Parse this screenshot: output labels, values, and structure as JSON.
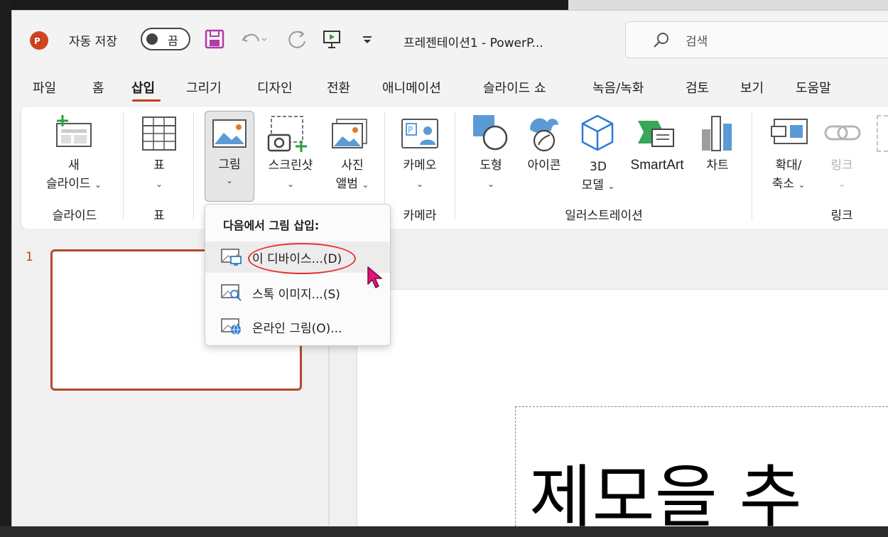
{
  "titlebar": {
    "autosave_label": "자동 저장",
    "autosave_toggle": "끔",
    "document_title": "프레젠테이션1  -  PowerP...",
    "search_placeholder": "검색"
  },
  "tabs": [
    {
      "label": "파일"
    },
    {
      "label": "홈"
    },
    {
      "label": "삽입"
    },
    {
      "label": "그리기"
    },
    {
      "label": "디자인"
    },
    {
      "label": "전환"
    },
    {
      "label": "애니메이션"
    },
    {
      "label": "슬라이드 쇼"
    },
    {
      "label": "녹음/녹화"
    },
    {
      "label": "검토"
    },
    {
      "label": "보기"
    },
    {
      "label": "도움말"
    }
  ],
  "ribbon": {
    "new_slide": {
      "line1": "새",
      "line2": "슬라이드"
    },
    "table": "표",
    "picture": "그림",
    "screenshot": "스크린샷",
    "photo_album": {
      "line1": "사진",
      "line2": "앨범"
    },
    "cameo": "카메오",
    "shapes": "도형",
    "icons": "아이콘",
    "model_3d": {
      "line1": "3D",
      "line2": "모델"
    },
    "smartart": "SmartArt",
    "chart": "차트",
    "zoom": {
      "line1": "확대/",
      "line2": "축소"
    },
    "link": "링크",
    "groups": {
      "slides": "슬라이드",
      "tables": "표",
      "camera": "카메라",
      "illustrations": "일러스트레이션",
      "links": "링크"
    }
  },
  "dropdown": {
    "header": "다음에서 그림 삽입:",
    "items": [
      {
        "label": "이 디바이스...(D)"
      },
      {
        "label": "스톡 이미지...(S)"
      },
      {
        "label": "온라인 그림(O)..."
      }
    ]
  },
  "slides_panel": {
    "slide_number": "1"
  },
  "slide": {
    "title_partial": "제모을 추"
  },
  "colors": {
    "accent": "#c43e1c",
    "highlight_circle": "#e8322f",
    "cursor": "#e0157a"
  }
}
